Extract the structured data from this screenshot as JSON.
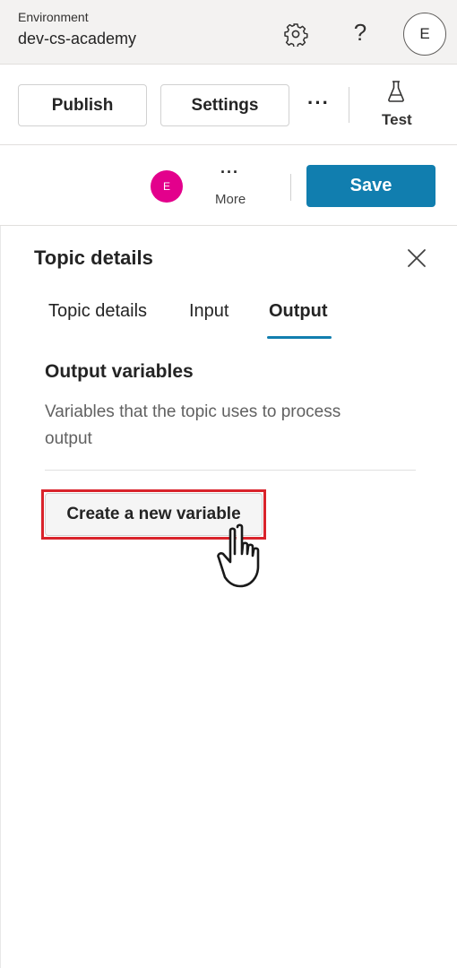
{
  "environment": {
    "label": "Environment",
    "name": "dev-cs-academy",
    "avatar_initial": "E"
  },
  "toolbar": {
    "publish_label": "Publish",
    "settings_label": "Settings",
    "overflow": "···",
    "test_label": "Test"
  },
  "savebar": {
    "avatar_initial": "E",
    "more_dots": "···",
    "more_label": "More",
    "save_label": "Save"
  },
  "panel": {
    "title": "Topic details",
    "tabs": [
      {
        "label": "Topic details"
      },
      {
        "label": "Input"
      },
      {
        "label": "Output",
        "selected": true
      }
    ],
    "section_heading": "Output variables",
    "section_description": "Variables that the topic uses to process output",
    "create_button_label": "Create a new variable"
  },
  "icons": {
    "settings": "gear-icon",
    "help": "question-icon",
    "test": "flask-icon",
    "close": "close-icon",
    "pointer": "hand-pointer-icon"
  },
  "colors": {
    "accent": "#117eaf",
    "avatar": "#e3008c",
    "highlight": "#d9232b"
  }
}
